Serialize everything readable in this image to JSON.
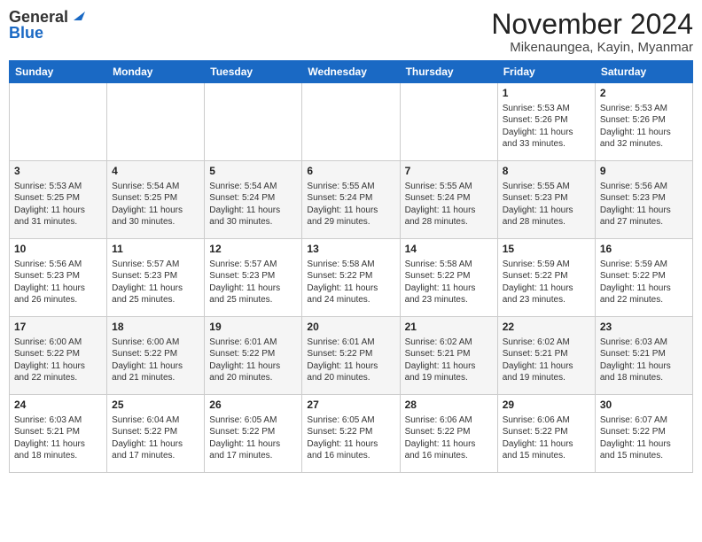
{
  "header": {
    "logo_general": "General",
    "logo_blue": "Blue",
    "month_title": "November 2024",
    "location": "Mikenaungea, Kayin, Myanmar"
  },
  "days_of_week": [
    "Sunday",
    "Monday",
    "Tuesday",
    "Wednesday",
    "Thursday",
    "Friday",
    "Saturday"
  ],
  "weeks": [
    [
      {
        "day": "",
        "info": ""
      },
      {
        "day": "",
        "info": ""
      },
      {
        "day": "",
        "info": ""
      },
      {
        "day": "",
        "info": ""
      },
      {
        "day": "",
        "info": ""
      },
      {
        "day": "1",
        "info": "Sunrise: 5:53 AM\nSunset: 5:26 PM\nDaylight: 11 hours\nand 33 minutes."
      },
      {
        "day": "2",
        "info": "Sunrise: 5:53 AM\nSunset: 5:26 PM\nDaylight: 11 hours\nand 32 minutes."
      }
    ],
    [
      {
        "day": "3",
        "info": "Sunrise: 5:53 AM\nSunset: 5:25 PM\nDaylight: 11 hours\nand 31 minutes."
      },
      {
        "day": "4",
        "info": "Sunrise: 5:54 AM\nSunset: 5:25 PM\nDaylight: 11 hours\nand 30 minutes."
      },
      {
        "day": "5",
        "info": "Sunrise: 5:54 AM\nSunset: 5:24 PM\nDaylight: 11 hours\nand 30 minutes."
      },
      {
        "day": "6",
        "info": "Sunrise: 5:55 AM\nSunset: 5:24 PM\nDaylight: 11 hours\nand 29 minutes."
      },
      {
        "day": "7",
        "info": "Sunrise: 5:55 AM\nSunset: 5:24 PM\nDaylight: 11 hours\nand 28 minutes."
      },
      {
        "day": "8",
        "info": "Sunrise: 5:55 AM\nSunset: 5:23 PM\nDaylight: 11 hours\nand 28 minutes."
      },
      {
        "day": "9",
        "info": "Sunrise: 5:56 AM\nSunset: 5:23 PM\nDaylight: 11 hours\nand 27 minutes."
      }
    ],
    [
      {
        "day": "10",
        "info": "Sunrise: 5:56 AM\nSunset: 5:23 PM\nDaylight: 11 hours\nand 26 minutes."
      },
      {
        "day": "11",
        "info": "Sunrise: 5:57 AM\nSunset: 5:23 PM\nDaylight: 11 hours\nand 25 minutes."
      },
      {
        "day": "12",
        "info": "Sunrise: 5:57 AM\nSunset: 5:23 PM\nDaylight: 11 hours\nand 25 minutes."
      },
      {
        "day": "13",
        "info": "Sunrise: 5:58 AM\nSunset: 5:22 PM\nDaylight: 11 hours\nand 24 minutes."
      },
      {
        "day": "14",
        "info": "Sunrise: 5:58 AM\nSunset: 5:22 PM\nDaylight: 11 hours\nand 23 minutes."
      },
      {
        "day": "15",
        "info": "Sunrise: 5:59 AM\nSunset: 5:22 PM\nDaylight: 11 hours\nand 23 minutes."
      },
      {
        "day": "16",
        "info": "Sunrise: 5:59 AM\nSunset: 5:22 PM\nDaylight: 11 hours\nand 22 minutes."
      }
    ],
    [
      {
        "day": "17",
        "info": "Sunrise: 6:00 AM\nSunset: 5:22 PM\nDaylight: 11 hours\nand 22 minutes."
      },
      {
        "day": "18",
        "info": "Sunrise: 6:00 AM\nSunset: 5:22 PM\nDaylight: 11 hours\nand 21 minutes."
      },
      {
        "day": "19",
        "info": "Sunrise: 6:01 AM\nSunset: 5:22 PM\nDaylight: 11 hours\nand 20 minutes."
      },
      {
        "day": "20",
        "info": "Sunrise: 6:01 AM\nSunset: 5:22 PM\nDaylight: 11 hours\nand 20 minutes."
      },
      {
        "day": "21",
        "info": "Sunrise: 6:02 AM\nSunset: 5:21 PM\nDaylight: 11 hours\nand 19 minutes."
      },
      {
        "day": "22",
        "info": "Sunrise: 6:02 AM\nSunset: 5:21 PM\nDaylight: 11 hours\nand 19 minutes."
      },
      {
        "day": "23",
        "info": "Sunrise: 6:03 AM\nSunset: 5:21 PM\nDaylight: 11 hours\nand 18 minutes."
      }
    ],
    [
      {
        "day": "24",
        "info": "Sunrise: 6:03 AM\nSunset: 5:21 PM\nDaylight: 11 hours\nand 18 minutes."
      },
      {
        "day": "25",
        "info": "Sunrise: 6:04 AM\nSunset: 5:22 PM\nDaylight: 11 hours\nand 17 minutes."
      },
      {
        "day": "26",
        "info": "Sunrise: 6:05 AM\nSunset: 5:22 PM\nDaylight: 11 hours\nand 17 minutes."
      },
      {
        "day": "27",
        "info": "Sunrise: 6:05 AM\nSunset: 5:22 PM\nDaylight: 11 hours\nand 16 minutes."
      },
      {
        "day": "28",
        "info": "Sunrise: 6:06 AM\nSunset: 5:22 PM\nDaylight: 11 hours\nand 16 minutes."
      },
      {
        "day": "29",
        "info": "Sunrise: 6:06 AM\nSunset: 5:22 PM\nDaylight: 11 hours\nand 15 minutes."
      },
      {
        "day": "30",
        "info": "Sunrise: 6:07 AM\nSunset: 5:22 PM\nDaylight: 11 hours\nand 15 minutes."
      }
    ]
  ]
}
